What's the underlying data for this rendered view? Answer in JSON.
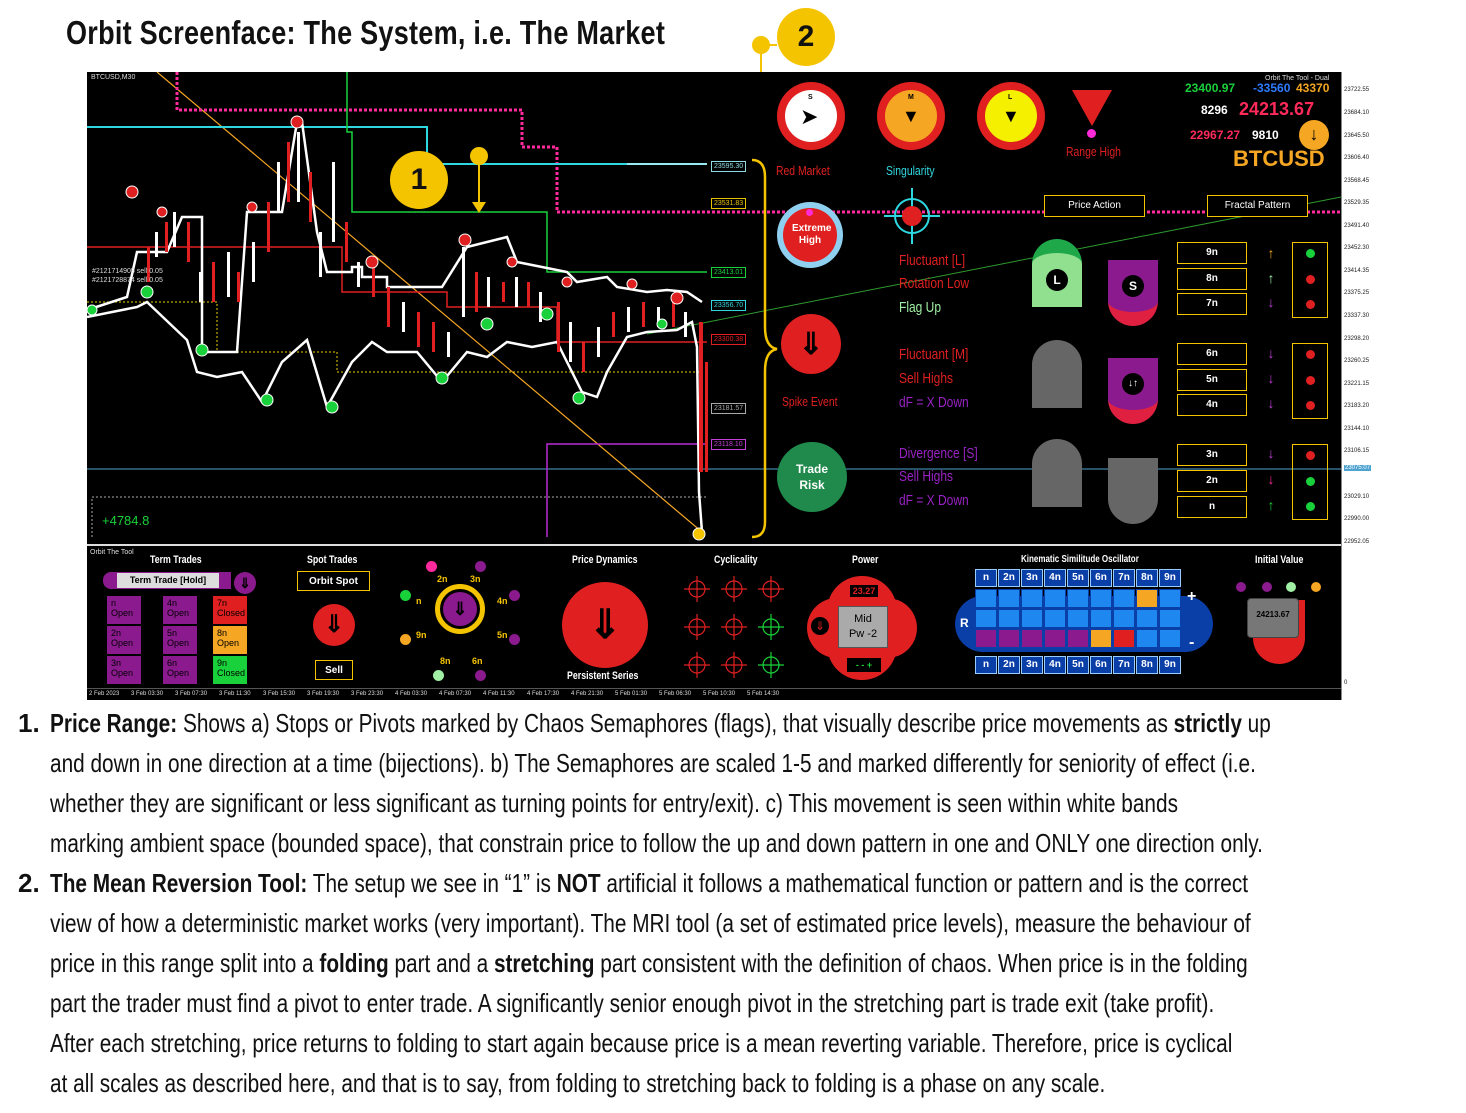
{
  "header": {
    "title": "Orbit Screenface: The System, i.e. The Market",
    "badge_1": "1",
    "badge_2": "2"
  },
  "chart": {
    "symbol": "BTCUSD,M30",
    "trade_lines": [
      "#2121714905 sell 0.05",
      "#2121728874 sell 0.05"
    ],
    "pnl": "+4784.8",
    "level_tags": [
      "23595.30",
      "23531.83",
      "23413.01",
      "23356.70",
      "23300.38",
      "23181.57",
      "23118.10"
    ],
    "current_price_tag": "23075.07",
    "price_axis": [
      "23722.55",
      "23684.10",
      "23645.50",
      "23606.40",
      "23568.45",
      "23529.35",
      "23491.40",
      "23452.30",
      "23414.35",
      "23375.25",
      "23337.30",
      "23298.20",
      "23260.25",
      "23221.15",
      "23183.20",
      "23144.10",
      "23106.15",
      "23067.05",
      "23029.10",
      "22990.00",
      "22952.05",
      "0"
    ],
    "time_axis": [
      "2 Feb 2023",
      "3 Feb 03:30",
      "3 Feb 07:30",
      "3 Feb 11:30",
      "3 Feb 15:30",
      "3 Feb 19:30",
      "3 Feb 23:30",
      "4 Feb 03:30",
      "4 Feb 07:30",
      "4 Feb 11:30",
      "4 Feb 17:30",
      "4 Feb 21:30",
      "5 Feb 01:30",
      "5 Feb 06:30",
      "5 Feb 10:30",
      "5 Feb 14:30"
    ]
  },
  "signals": {
    "s_label": "S",
    "m_label": "M",
    "l_label": "L",
    "range_high": "Range High",
    "red_market": "Red Market",
    "singularity": "Singularity",
    "extreme_high": "Extreme High",
    "spike_event": "Spike Event",
    "trade_risk": "Trade Risk",
    "fluctuant_l": "Fluctuant [L]",
    "rotation_low": "Rotation Low",
    "flag_up": "Flag Up",
    "fluctuant_m": "Fluctuant [M]",
    "sell_highs_1": "Sell Highs",
    "df_down_1": "dF = X Down",
    "divergence_s": "Divergence [S]",
    "sell_highs_2": "Sell Highs",
    "df_down_2": "dF = X Down",
    "price_action": "Price Action",
    "fractal_pattern": "Fractal Pattern",
    "shape_l": "L",
    "shape_s": "S"
  },
  "quote": {
    "tool_name": "Orbit The Tool - Dual",
    "v1": "23400.97",
    "v2": "-33560",
    "v3": "43370",
    "v4": "8296",
    "price": "24213.67",
    "v5": "22967.27",
    "v6": "9810",
    "symbol": "BTCUSD"
  },
  "fractals": [
    "9n",
    "8n",
    "7n",
    "6n",
    "5n",
    "4n",
    "3n",
    "2n",
    "n"
  ],
  "panel": {
    "tool": "Orbit The Tool",
    "term_trades": "Term Trades",
    "term_trade_hold": "Term Trade [Hold]",
    "term_cells": [
      {
        "n": "n",
        "s": "Open"
      },
      {
        "n": "4n",
        "s": "Open"
      },
      {
        "n": "7n",
        "s": "Closed"
      },
      {
        "n": "2n",
        "s": "Open"
      },
      {
        "n": "5n",
        "s": "Open"
      },
      {
        "n": "8n",
        "s": "Open"
      },
      {
        "n": "3n",
        "s": "Open"
      },
      {
        "n": "6n",
        "s": "Open"
      },
      {
        "n": "9n",
        "s": "Closed"
      }
    ],
    "spot_trades": "Spot Trades",
    "orbit_spot": "Orbit Spot",
    "sell": "Sell",
    "dial_labels": [
      "2n",
      "3n",
      "4n",
      "5n",
      "6n",
      "8n",
      "9n",
      "n"
    ],
    "price_dynamics": "Price Dynamics",
    "persistent_series": "Persistent Series",
    "cyclicality": "Cyclicality",
    "power": "Power",
    "power_value": "23.27",
    "power_mid": "Mid",
    "power_pw": "Pw -2",
    "power_ctrl": "- - +",
    "kso_title": "Kinematic Similitude Oscillator",
    "kso_headers": [
      "n",
      "2n",
      "3n",
      "4n",
      "5n",
      "6n",
      "7n",
      "8n",
      "9n"
    ],
    "kso_r": "R",
    "kso_plus": "+",
    "kso_minus": "-",
    "initial_value": "Initial Value",
    "initial_value_price": "24213.67"
  },
  "description": {
    "item1_num": "1.",
    "item1_l1_bold": "Price Range:",
    "item1_l1_a": " Shows a) Stops or Pivots marked by Chaos Semaphores (flags), that visually describe price movements as ",
    "item1_l1_bold2": "strictly",
    "item1_l1_b": " up",
    "item1_l2": "and down in one direction at a time (bijections). b) The Semaphores are scaled 1-5 and marked differently for seniority of effect (i.e.",
    "item1_l3": "whether they are significant or less significant as turning points for entry/exit). c) This movement is seen within white bands",
    "item1_l4": "marking ambient space (bounded space), that constrain price to follow the up and down pattern in one and ONLY one direction only.",
    "item2_num": "2.",
    "item2_l1_bold": "The Mean Reversion Tool:",
    "item2_l1_a": " The setup we see in “1” is ",
    "item2_l1_bold2": "NOT",
    "item2_l1_b": " artificial it follows a mathematical function or pattern and is the correct",
    "item2_l2": "view of how a deterministic market works (very important). The MRI tool (a set of estimated price levels), measure the behaviour of",
    "item2_l3_a": "price in this range split into a ",
    "item2_l3_bold": "folding",
    "item2_l3_b": " part and a ",
    "item2_l3_bold2": "stretching",
    "item2_l3_c": " part consistent with the definition of chaos. When price is in the folding",
    "item2_l4": "part the trader must find a pivot to enter trade. A significantly senior enough pivot in the stretching part is trade exit (take profit).",
    "item2_l5": "After each stretching, price returns to folding to start again because price is a mean reverting variable. Therefore, price is cyclical",
    "item2_l6": "at all scales as described here, and that is to say, from folding to stretching back to folding is a phase on any scale."
  }
}
